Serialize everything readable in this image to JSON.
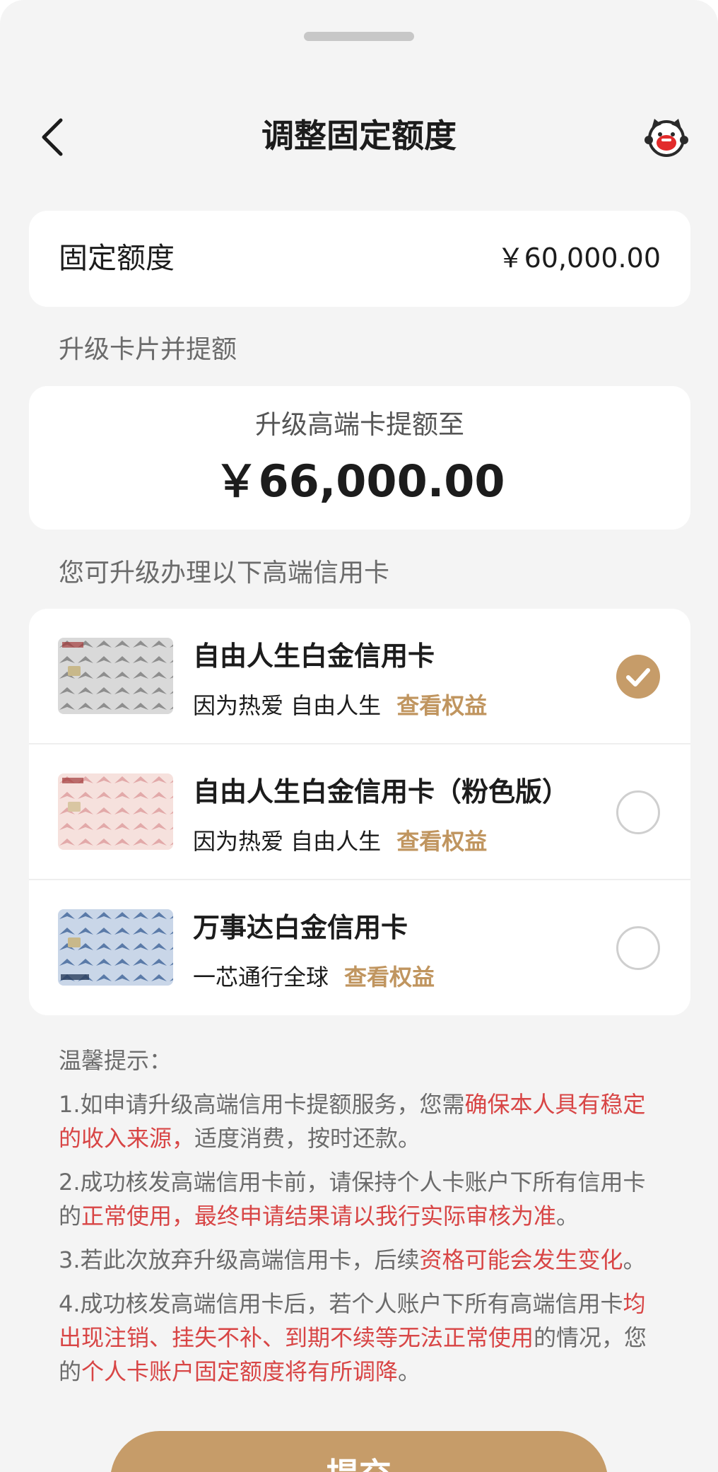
{
  "header": {
    "title": "调整固定额度"
  },
  "quota": {
    "label": "固定额度",
    "value": "￥60,000.00"
  },
  "upgrade_section": {
    "label": "升级卡片并提额",
    "subtitle": "升级高端卡提额至",
    "amount": "￥66,000.00"
  },
  "cards_section": {
    "label": "您可升级办理以下高端信用卡",
    "cards": [
      {
        "name": "自由人生白金信用卡",
        "tagline": "因为热爱 自由人生",
        "link": "查看权益",
        "selected": true
      },
      {
        "name": "自由人生白金信用卡（粉色版）",
        "tagline": "因为热爱 自由人生",
        "link": "查看权益",
        "selected": false
      },
      {
        "name": "万事达白金信用卡",
        "tagline": "一芯通行全球",
        "link": "查看权益",
        "selected": false
      }
    ]
  },
  "tips": {
    "title": "温馨提示：",
    "t1": {
      "a": "1.如申请升级高端信用卡提额服务，您需",
      "b": "确保本人具有稳定的收入来源，",
      "c": "适度消费，按时还款。"
    },
    "t2": {
      "a": "2.成功核发高端信用卡前，请保持个人卡账户下所有信用卡的",
      "b": "正常使用，最终申请结果请以我行实际审核为准",
      "c": "。"
    },
    "t3": {
      "a": "3.若此次放弃升级高端信用卡，后续",
      "b": "资格可能会发生变化",
      "c": "。"
    },
    "t4": {
      "a": "4.成功核发高端信用卡后，若个人账户下所有高端信用卡",
      "b": "均出现注销、挂失不补、到期不续等无法正常使用",
      "c": "的情况，您的",
      "d": "个人卡账户固定额度将有所调降",
      "e": "。"
    }
  },
  "submit": {
    "label": "提交"
  },
  "icons": {
    "back": "chevron-left-icon",
    "mascot": "mascot-icon",
    "check": "check-icon"
  },
  "colors": {
    "accent": "#c69c69",
    "highlight": "#d84545",
    "background": "#f4f4f4"
  }
}
